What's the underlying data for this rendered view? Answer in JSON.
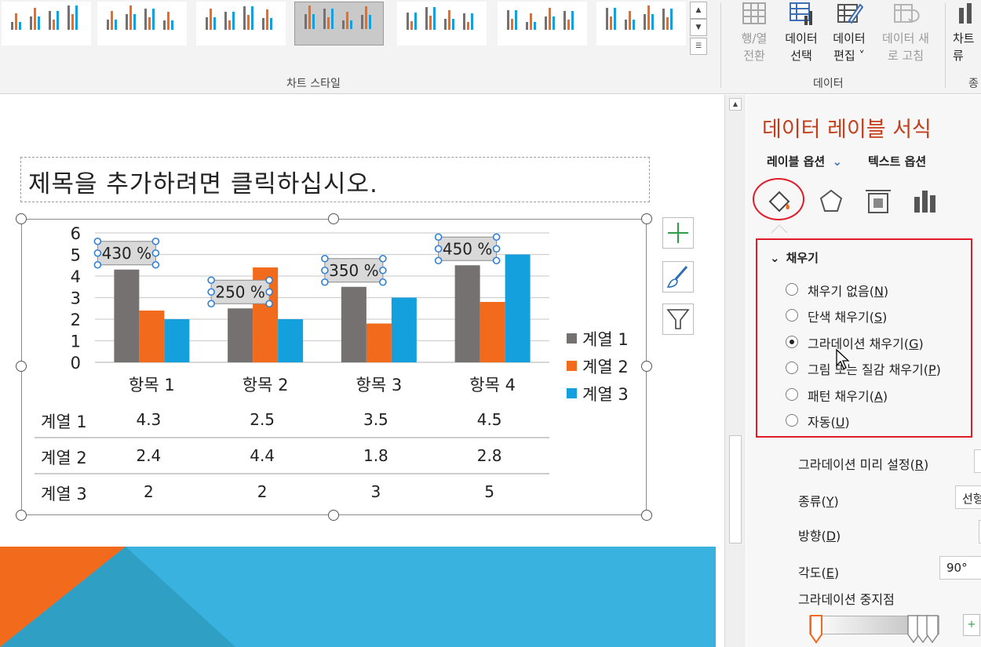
{
  "ribbon": {
    "chart_styles_group": "차트 스타일",
    "data_group": "데이터",
    "buttons": {
      "switch_row_col": [
        "행/열",
        "전환"
      ],
      "select_data": [
        "데이터",
        "선택"
      ],
      "edit_data": [
        "데이터",
        "편집 ˅"
      ],
      "refresh_data": [
        "데이터 새",
        "로 고침"
      ],
      "change_chart": [
        "차트",
        "류 "
      ],
      "partial_group": "종"
    }
  },
  "slide": {
    "title_placeholder": "제목을 추가하려면 클릭하십시오."
  },
  "chart_data": {
    "type": "bar",
    "categories": [
      "항목 1",
      "항목 2",
      "항목 3",
      "항목 4"
    ],
    "series": [
      {
        "name": "계열 1",
        "values": [
          4.3,
          2.5,
          3.5,
          4.5
        ],
        "color": "#767171"
      },
      {
        "name": "계열 2",
        "values": [
          2.4,
          4.4,
          1.8,
          2.8
        ],
        "color": "#f26b1d"
      },
      {
        "name": "계열 3",
        "values": [
          2,
          2,
          3,
          5
        ],
        "color": "#14a0dc"
      }
    ],
    "ylim": [
      0,
      6
    ],
    "yticks": [
      "0",
      "1",
      "2",
      "3",
      "4",
      "5",
      "6"
    ],
    "data_labels": [
      "430 %",
      "250 %",
      "350 %",
      "450 %"
    ],
    "legend_placement": "right",
    "grid": true,
    "data_table": {
      "rows": [
        {
          "name": "계열 1",
          "cells": [
            "4.3",
            "2.5",
            "3.5",
            "4.5"
          ]
        },
        {
          "name": "계열 2",
          "cells": [
            "2.4",
            "4.4",
            "1.8",
            "2.8"
          ]
        },
        {
          "name": "계열 3",
          "cells": [
            "2",
            "2",
            "3",
            "5"
          ]
        }
      ]
    }
  },
  "pane": {
    "title": "데이터 레이블 서식",
    "tab_label_options": "레이블 옵션",
    "tab_text_options": "텍스트 옵션",
    "fill_header": "채우기",
    "fill_options": [
      {
        "label": "채우기 없음",
        "key": "N",
        "selected": false
      },
      {
        "label": "단색 채우기",
        "key": "S",
        "selected": false
      },
      {
        "label": "그라데이션 채우기",
        "key": "G",
        "selected": true
      },
      {
        "label": "그림 또는 질감 채우기",
        "key": "P",
        "selected": false
      },
      {
        "label": "패턴 채우기",
        "key": "A",
        "selected": false
      },
      {
        "label": "자동",
        "key": "U",
        "selected": false
      }
    ],
    "gradient_preset": {
      "label": "그라데이션 미리 설정",
      "key": "R"
    },
    "type": {
      "label": "종류",
      "key": "Y",
      "value": "선형"
    },
    "direction": {
      "label": "방향",
      "key": "D"
    },
    "angle": {
      "label": "각도",
      "key": "E",
      "value": "90°"
    },
    "gradient_stops": {
      "label": "그라데이션 중지점"
    }
  },
  "colors": {
    "accent_title": "#c43e1c",
    "highlight": "#e01b2a",
    "slide_orange": "#f26b1d",
    "slide_blue": "#3ab2df"
  }
}
